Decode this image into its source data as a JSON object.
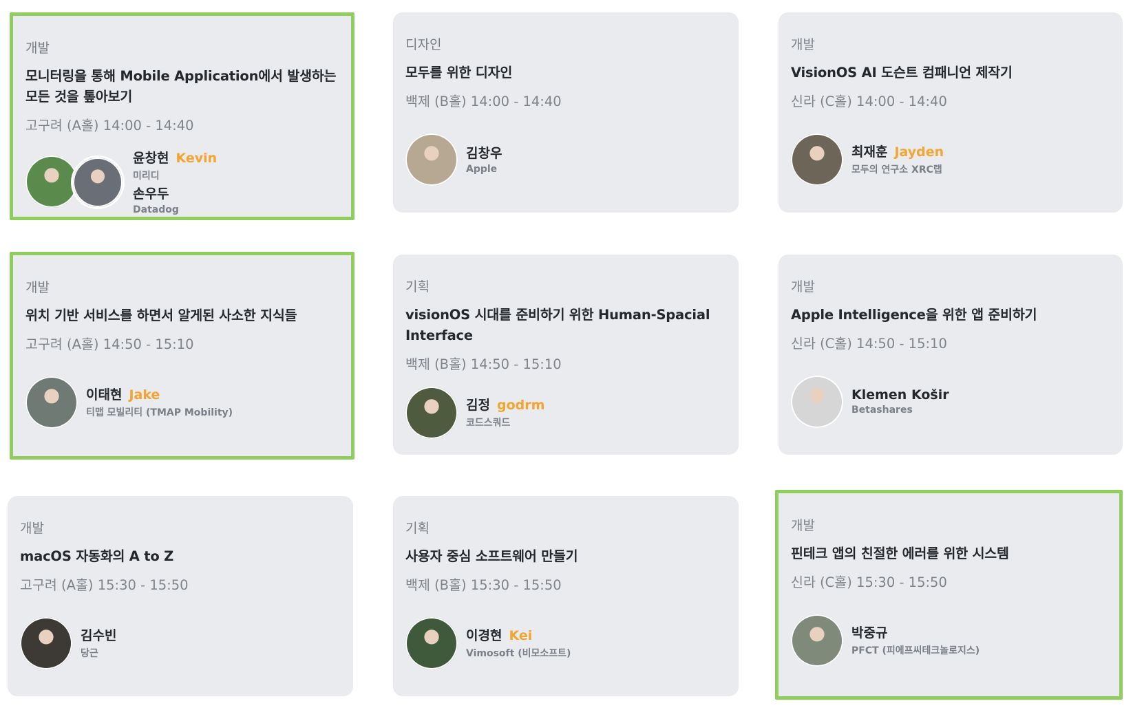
{
  "sessions": [
    {
      "category": "개발",
      "title": "모니터링을 통해 Mobile Application에서 발생하는 모든 것을 톺아보기",
      "time": "고구려 (A홀) 14:00 - 14:40",
      "highlighted": true,
      "speakers": [
        {
          "name": "윤창현",
          "nickname": "Kevin",
          "org": "미리디"
        },
        {
          "name": "손우두",
          "nickname": "",
          "org": "Datadog"
        }
      ]
    },
    {
      "category": "디자인",
      "title": "모두를 위한 디자인",
      "time": "백제 (B홀) 14:00 - 14:40",
      "highlighted": false,
      "speakers": [
        {
          "name": "김창우",
          "nickname": "",
          "org": "Apple"
        }
      ]
    },
    {
      "category": "개발",
      "title": "VisionOS AI 도슨트 컴패니언 제작기",
      "time": "신라 (C홀) 14:00 - 14:40",
      "highlighted": false,
      "speakers": [
        {
          "name": "최재훈",
          "nickname": "Jayden",
          "org": "모두의 연구소 XRC랩"
        }
      ]
    },
    {
      "category": "개발",
      "title": "위치 기반 서비스를 하면서 알게된 사소한 지식들",
      "time": "고구려 (A홀) 14:50 - 15:10",
      "highlighted": true,
      "speakers": [
        {
          "name": "이태현",
          "nickname": "Jake",
          "org": "티맵 모빌리티 (TMAP Mobility)"
        }
      ]
    },
    {
      "category": "기획",
      "title": "visionOS 시대를 준비하기 위한 Human-Spacial Interface",
      "time": "백제 (B홀) 14:50 - 15:10",
      "highlighted": false,
      "speakers": [
        {
          "name": "김정",
          "nickname": "godrm",
          "org": "코드스쿼드"
        }
      ]
    },
    {
      "category": "개발",
      "title": "Apple Intelligence을 위한 앱 준비하기",
      "time": "신라 (C홀) 14:50 - 15:10",
      "highlighted": false,
      "speakers": [
        {
          "name": "Klemen Košir",
          "nickname": "",
          "org": "Betashares"
        }
      ]
    },
    {
      "category": "개발",
      "title": "macOS 자동화의 A to Z",
      "time": "고구려 (A홀) 15:30 - 15:50",
      "highlighted": false,
      "speakers": [
        {
          "name": "김수빈",
          "nickname": "",
          "org": "당근"
        }
      ]
    },
    {
      "category": "기획",
      "title": "사용자 중심 소프트웨어 만들기",
      "time": "백제 (B홀) 15:30 - 15:50",
      "highlighted": false,
      "speakers": [
        {
          "name": "이경현",
          "nickname": "Kei",
          "org": "Vimosoft (비모소프트)"
        }
      ]
    },
    {
      "category": "개발",
      "title": "핀테크 앱의 친절한 에러를 위한 시스템",
      "time": "신라 (C홀) 15:30 - 15:50",
      "highlighted": true,
      "speakers": [
        {
          "name": "박중규",
          "nickname": "",
          "org": "PFCT (피에프씨테크놀로지스)"
        }
      ]
    }
  ],
  "colors": {
    "card_bg": "#e9ebee",
    "highlight_border": "#8fce5e",
    "nickname": "#f3a431",
    "muted_text": "#7f848b"
  }
}
